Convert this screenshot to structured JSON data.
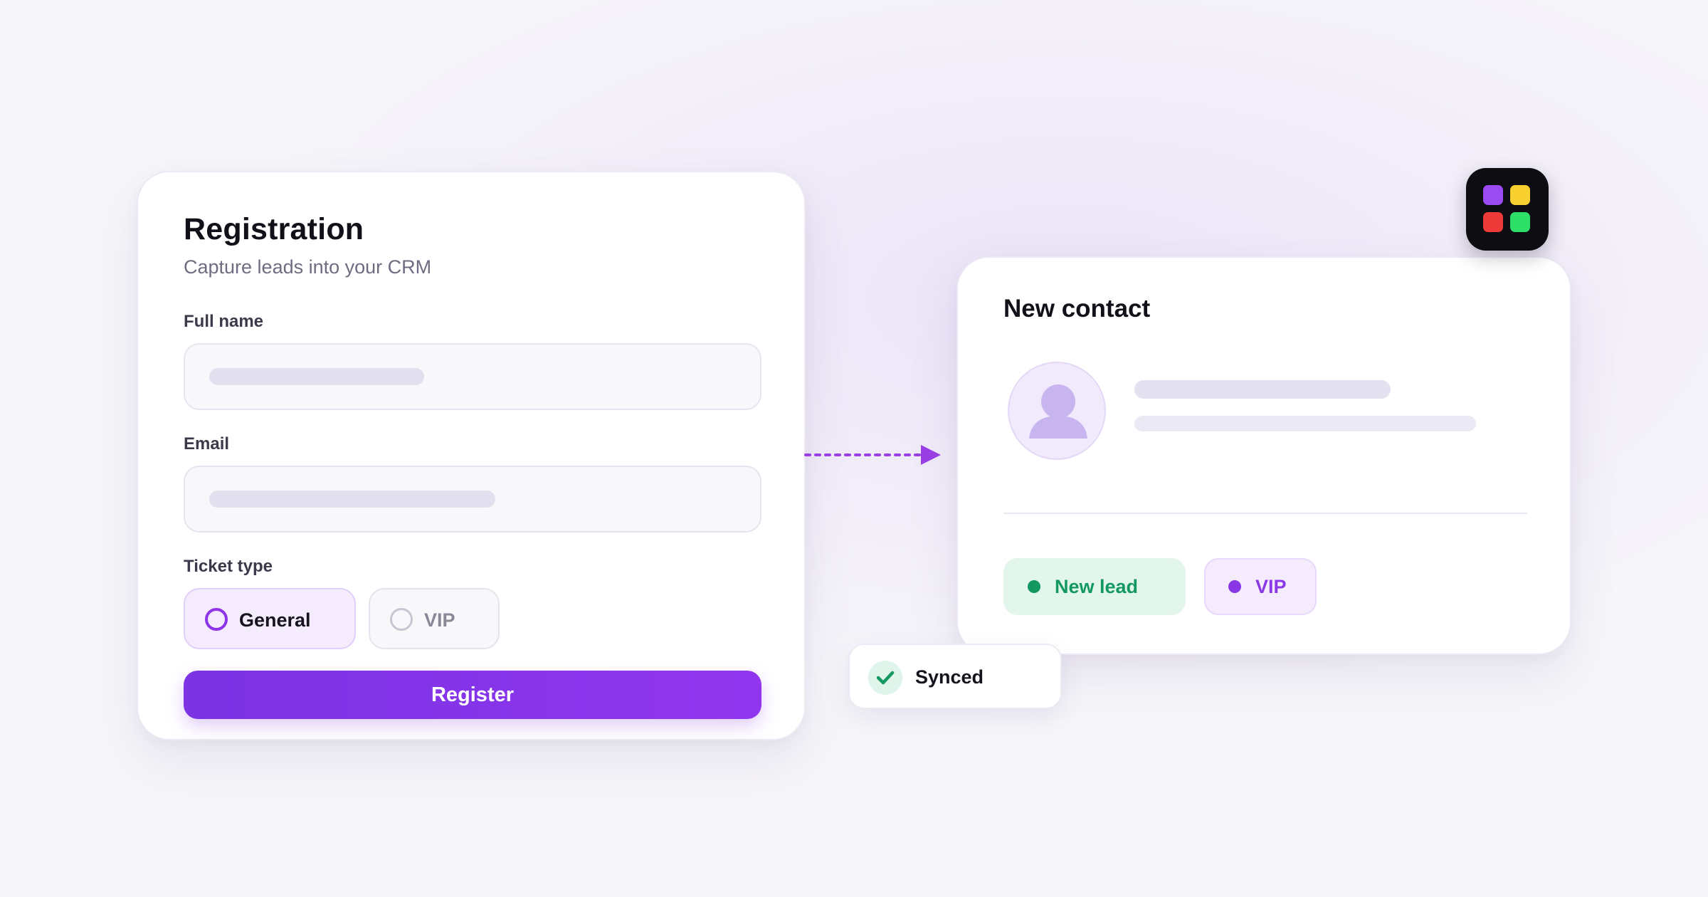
{
  "registration": {
    "title": "Registration",
    "subtitle": "Capture leads into your CRM",
    "fields": [
      {
        "label": "Full name"
      },
      {
        "label": "Email"
      }
    ],
    "ticket_type": {
      "label": "Ticket type",
      "options": [
        "General",
        "VIP"
      ],
      "selected": "General"
    },
    "submit_label": "Register"
  },
  "contact": {
    "title": "New contact",
    "tags": [
      {
        "label": "New lead",
        "color": "#129860"
      },
      {
        "label": "VIP",
        "color": "#8a37e6"
      }
    ]
  },
  "toast": {
    "label": "Synced"
  },
  "colors": {
    "accent": "#8e34e8",
    "success": "#129860",
    "logo_squares": [
      "#9a4cf2",
      "#f7cf2e",
      "#ef3a3a",
      "#2ee06a"
    ]
  },
  "icons": [
    "user-avatar-icon",
    "check-icon",
    "arrow-right-icon",
    "app-logo-icon"
  ]
}
